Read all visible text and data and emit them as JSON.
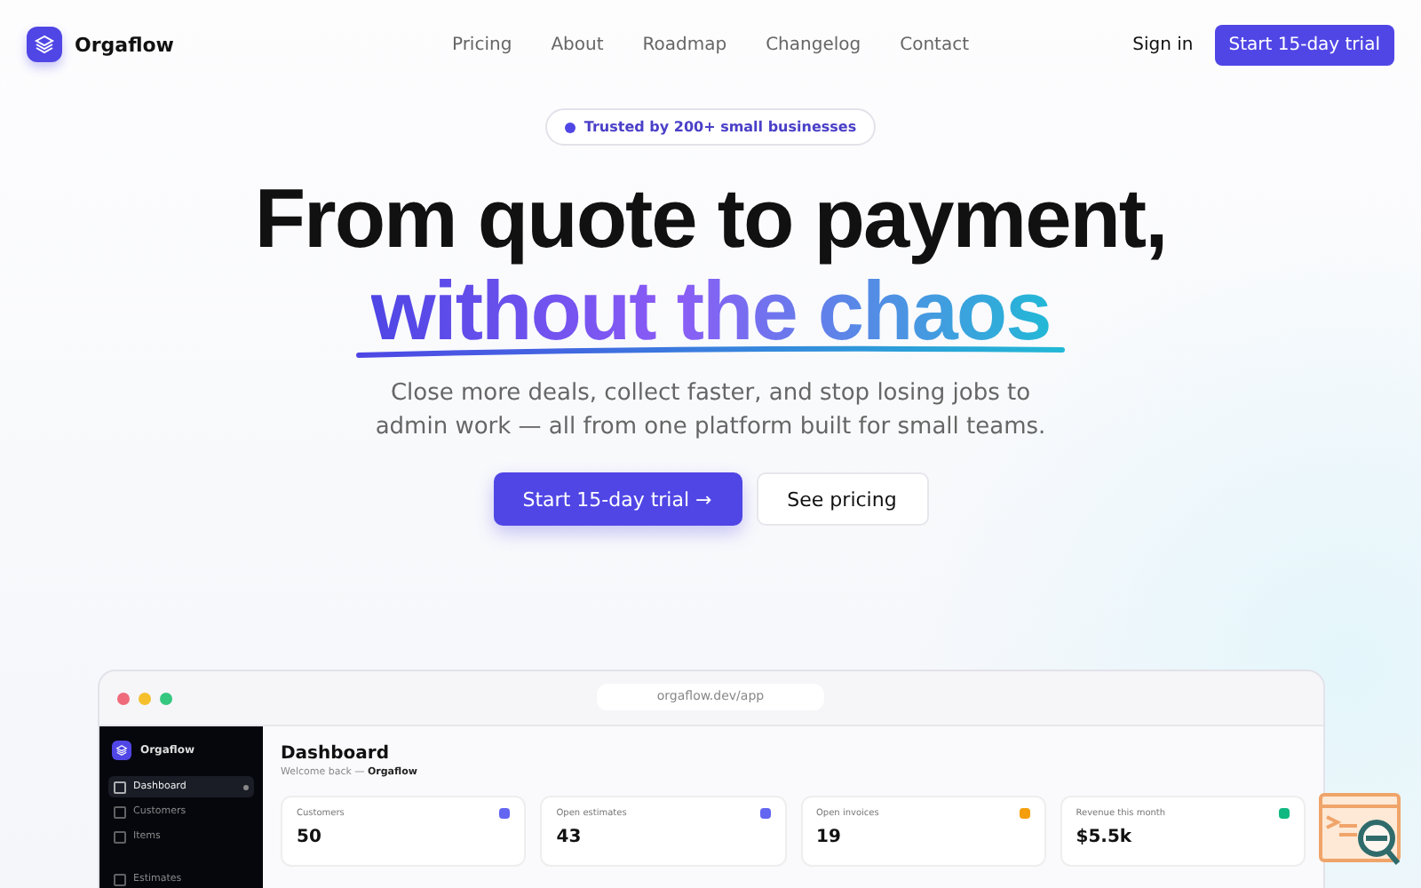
{
  "brand": {
    "name": "Orgaflow"
  },
  "nav": [
    {
      "label": "Pricing"
    },
    {
      "label": "About"
    },
    {
      "label": "Roadmap"
    },
    {
      "label": "Changelog"
    },
    {
      "label": "Contact"
    }
  ],
  "sign_in": "Sign in",
  "header_cta": "Start 15-day trial",
  "badge": "Trusted by 200+ small businesses",
  "headline": "From quote to payment,",
  "headline_accent": "without the chaos",
  "subtitle": "Close more deals, collect faster, and stop losing jobs to admin work — all from one platform built for small teams.",
  "primary_cta": "Start 15-day trial",
  "primary_cta_arrow": "→",
  "secondary_cta": "See pricing",
  "app_preview": {
    "url": "orgaflow.dev/app",
    "brand": "Orgaflow",
    "sidebar": [
      {
        "label": "Dashboard",
        "selected": true
      },
      {
        "label": "Customers",
        "selected": false
      },
      {
        "label": "Items",
        "selected": false
      },
      {
        "label": "Estimates",
        "selected": false
      }
    ],
    "title": "Dashboard",
    "welcome": "Welcome back — **Orgaflow**",
    "stats": [
      {
        "label": "Customers",
        "value": "50",
        "color": "#6366f1"
      },
      {
        "label": "Open estimates",
        "value": "43",
        "color": "#6366f1"
      },
      {
        "label": "Open invoices",
        "value": "19",
        "color": "#f59e0b"
      },
      {
        "label": "Revenue this month",
        "value": "$5.5k",
        "color": "#10b981"
      }
    ]
  }
}
